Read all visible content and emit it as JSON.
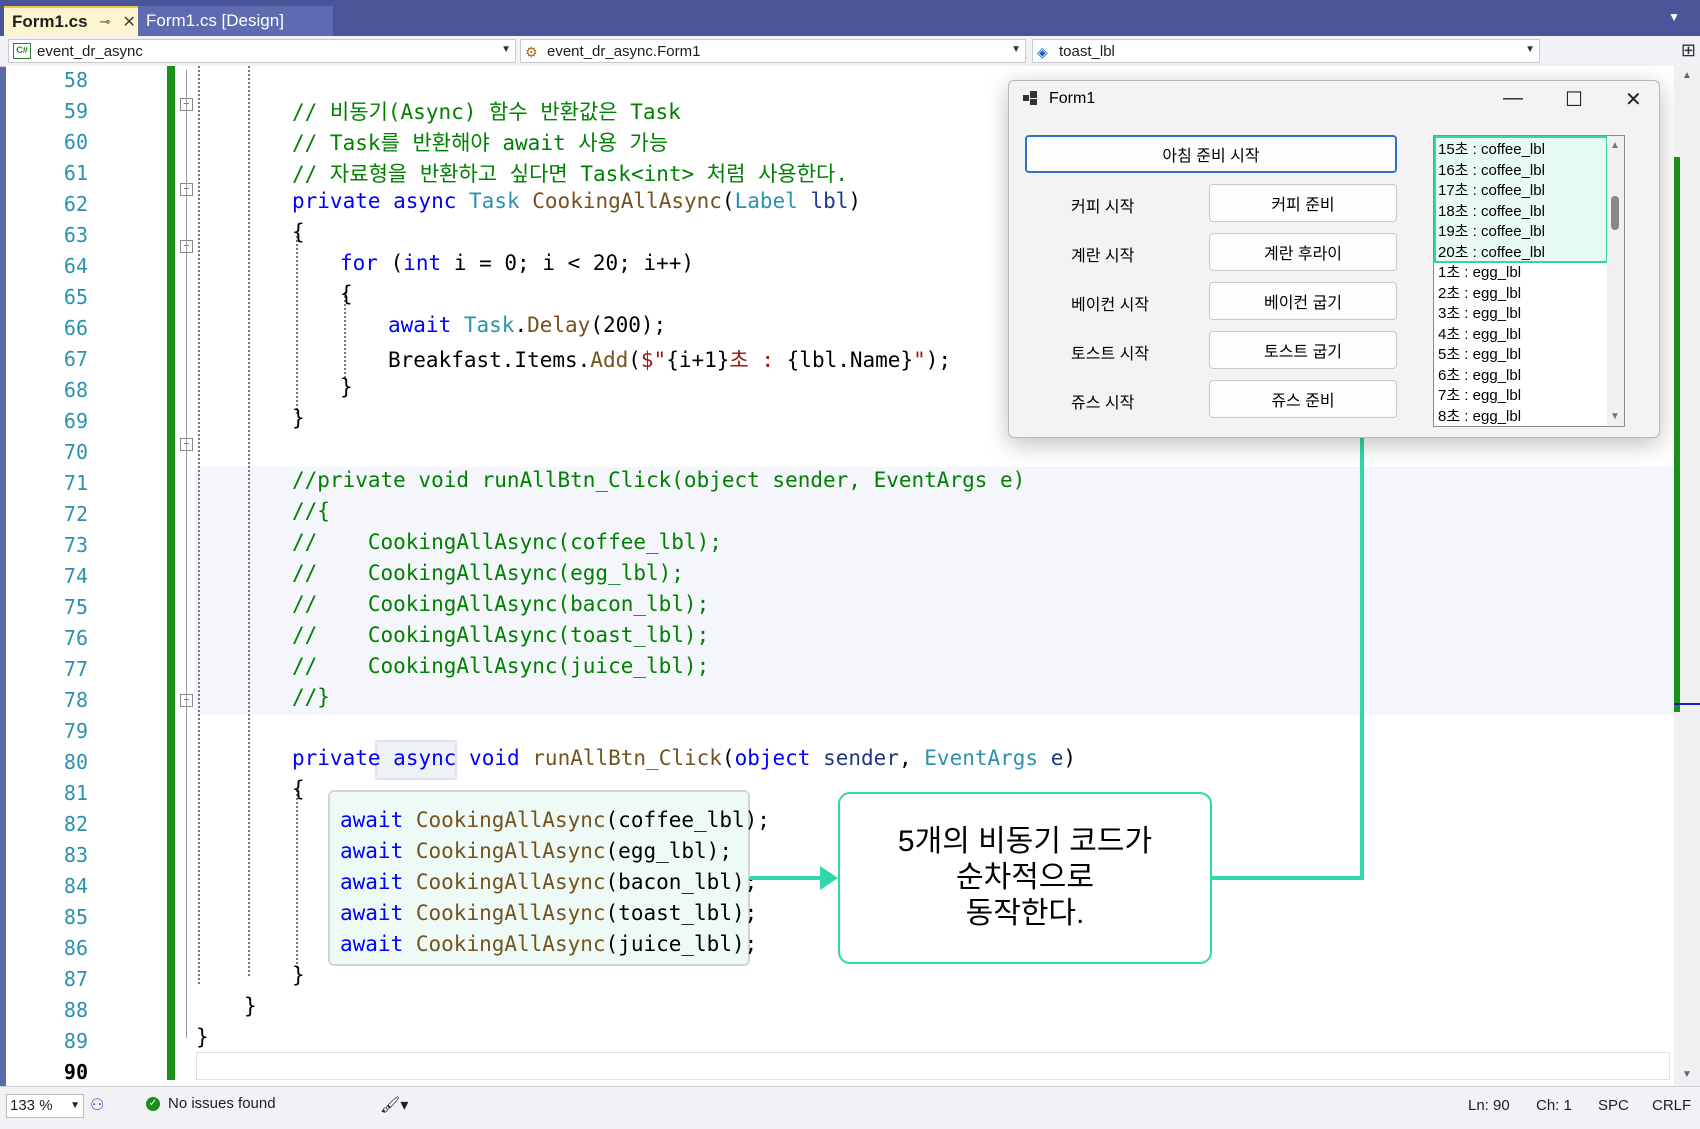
{
  "tabs": {
    "active": "Form1.cs",
    "inactive": "Form1.cs [Design]"
  },
  "nav": {
    "project": "event_dr_async",
    "class": "event_dr_async.Form1",
    "member": "toast_lbl"
  },
  "line_numbers": [
    "58",
    "59",
    "60",
    "61",
    "62",
    "63",
    "64",
    "65",
    "66",
    "67",
    "68",
    "69",
    "70",
    "71",
    "72",
    "73",
    "74",
    "75",
    "76",
    "77",
    "78",
    "79",
    "80",
    "81",
    "82",
    "83",
    "84",
    "85",
    "86",
    "87",
    "88",
    "89",
    "90"
  ],
  "code": {
    "l59": "// 비동기(Async) 함수 반환값은 Task",
    "l60": "// Task를 반환해야 await 사용 가능",
    "l61": "// 자료형을 반환하고 싶다면 Task<int> 처럼 사용한다.",
    "l62_kw": "private async",
    "l62_ty": "Task",
    "l62_me": "CookingAllAsync",
    "l62_p1": "(",
    "l62_ty2": "Label",
    "l62_pa": "lbl",
    "l62_end": ")",
    "brace_open": "{",
    "brace_close": "}",
    "l64_kw": "for",
    "l64_a": "(",
    "l64_kw2": "int",
    "l64_b": "i = 0; i < 20; i++)",
    "l66_kw": "await",
    "l66_ty": "Task",
    "l66_me": "Delay",
    "l66_rest": "(200);",
    "l67_a": "Breakfast.Items.",
    "l67_me": "Add",
    "l67_b": "(",
    "l67_st1": "$\"",
    "l67_c": "{i+1}",
    "l67_st2": "초 : ",
    "l67_d": "{lbl.Name}",
    "l67_st3": "\"",
    "l67_e": ");",
    "l71": "//private void runAllBtn_Click(object sender, EventArgs e)",
    "l72": "//{",
    "l73": "//    CookingAllAsync(coffee_lbl);",
    "l74": "//    CookingAllAsync(egg_lbl);",
    "l75": "//    CookingAllAsync(bacon_lbl);",
    "l76": "//    CookingAllAsync(toast_lbl);",
    "l77": "//    CookingAllAsync(juice_lbl);",
    "l78": "//}",
    "l80_kw1": "private",
    "l80_kw2": "async",
    "l80_kw3": "void",
    "l80_me": "runAllBtn_Click",
    "l80_p": "(",
    "l80_kw4": "object",
    "l80_pa1": "sender",
    "l80_c": ",",
    "l80_ty": "EventArgs",
    "l80_pa2": "e",
    "l80_e": ")",
    "await_kw": "await",
    "await_me": "CookingAllAsync",
    "await_args": [
      "(coffee_lbl);",
      "(egg_lbl);",
      "(bacon_lbl);",
      "(toast_lbl);",
      "(juice_lbl);"
    ]
  },
  "callout": {
    "line1": "5개의 비동기 코드가",
    "line2": "순차적으로",
    "line3": "동작한다."
  },
  "form1": {
    "title": "Form1",
    "start_all": "아침 준비 시작",
    "rows": [
      {
        "label": "커피 시작",
        "button": "커피 준비"
      },
      {
        "label": "계란 시작",
        "button": "계란 후라이"
      },
      {
        "label": "베이컨 시작",
        "button": "베이컨 굽기"
      },
      {
        "label": "토스트 시작",
        "button": "토스트 굽기"
      },
      {
        "label": "쥬스 시작",
        "button": "쥬스 준비"
      }
    ],
    "list_items": [
      "15초 : coffee_lbl",
      "16초 : coffee_lbl",
      "17초 : coffee_lbl",
      "18초 : coffee_lbl",
      "19초 : coffee_lbl",
      "20초 : coffee_lbl",
      "1초 : egg_lbl",
      "2초 : egg_lbl",
      "3초 : egg_lbl",
      "4초 : egg_lbl",
      "5초 : egg_lbl",
      "6초 : egg_lbl",
      "7초 : egg_lbl",
      "8초 : egg_lbl"
    ]
  },
  "status": {
    "zoom": "133 %",
    "issues": "No issues found",
    "ln": "Ln: 90",
    "ch": "Ch: 1",
    "spc": "SPC",
    "crlf": "CRLF"
  },
  "colors": {
    "accent_teal": "#2ed8a8",
    "change_green": "#1a8f1a",
    "comment": "#008000",
    "keyword": "#0000ff",
    "type": "#2b91af"
  }
}
